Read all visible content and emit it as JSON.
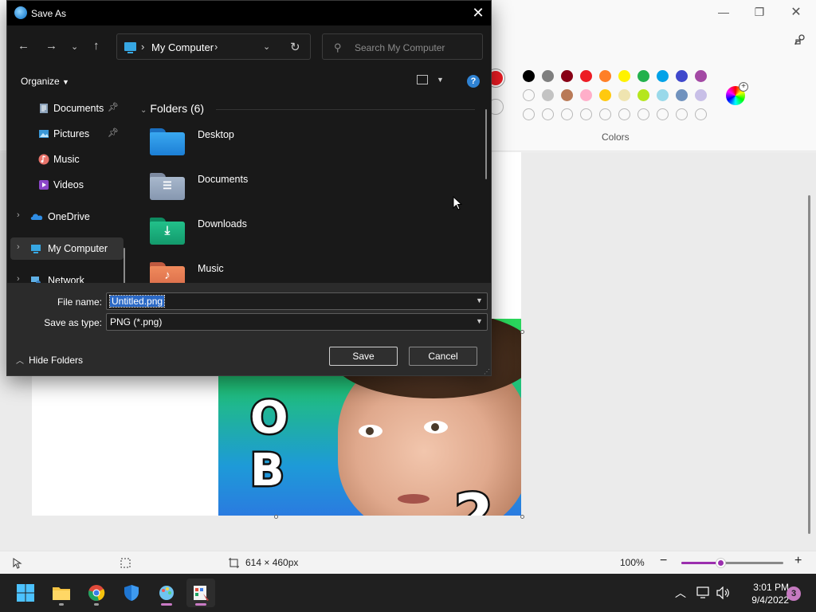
{
  "paint": {
    "colors_label": "Colors",
    "canvas_size": "614 × 460px",
    "zoom": "100%",
    "zoom_level_fraction": 0.38,
    "swatch_row1": [
      "#000000",
      "#7f7f7f",
      "#880015",
      "#ed1c24",
      "#ff7f27",
      "#fff200",
      "#22b14c",
      "#00a2e8",
      "#3f48cc",
      "#a349a4"
    ],
    "swatch_row2": [
      "",
      "#c3c3c3",
      "#b97a57",
      "#ffaec9",
      "#ffc90e",
      "#efe4b0",
      "#b5e61d",
      "#99d9ea",
      "#7092be",
      "#c8bfe7"
    ]
  },
  "dialog": {
    "title": "Save As",
    "address": "My Computer",
    "search_placeholder": "Search My Computer",
    "organize": "Organize",
    "sidebar": [
      {
        "label": "Documents",
        "pinned": true
      },
      {
        "label": "Pictures",
        "pinned": true
      },
      {
        "label": "Music",
        "pinned": false
      },
      {
        "label": "Videos",
        "pinned": false
      },
      {
        "label": "OneDrive",
        "pinned": false
      },
      {
        "label": "My Computer",
        "pinned": false
      },
      {
        "label": "Network",
        "pinned": false
      }
    ],
    "folders_heading": "Folders (6)",
    "folders": [
      "Desktop",
      "Documents",
      "Downloads",
      "Music"
    ],
    "file_name_label": "File name:",
    "file_name_value": "Untitled.png",
    "save_type_label": "Save as type:",
    "save_type_value": "PNG (*.png)",
    "hide_folders": "Hide Folders",
    "save_label": "Save",
    "cancel_label": "Cancel"
  },
  "taskbar": {
    "time": "3:01 PM",
    "date": "9/4/2022",
    "notification_count": "3"
  },
  "image_text": {
    "letter1": "O",
    "letter2": "B",
    "number": "2"
  }
}
